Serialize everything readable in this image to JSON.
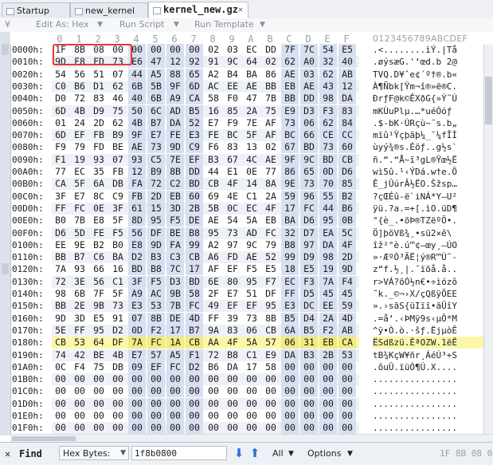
{
  "tabs": [
    {
      "label": "Startup",
      "active": false
    },
    {
      "label": "new_kernel",
      "active": false
    },
    {
      "label": "kernel_new.gz",
      "active": true
    }
  ],
  "toolbar": {
    "edit_as": "Edit As: Hex",
    "run_script": "Run Script",
    "run_template": "Run Template"
  },
  "header": {
    "columns": [
      "0",
      "1",
      "2",
      "3",
      "4",
      "5",
      "6",
      "7",
      "8",
      "9",
      "A",
      "B",
      "C",
      "D",
      "E",
      "F"
    ],
    "ascii": "0123456789ABCDEF"
  },
  "rows": [
    {
      "addr": "0000h:",
      "bytes": [
        "1F",
        "8B",
        "08",
        "00",
        "00",
        "00",
        "00",
        "00",
        "02",
        "03",
        "EC",
        "DD",
        "7F",
        "7C",
        "54",
        "E5"
      ],
      "ascii": ".<........ìÝ.|Tå"
    },
    {
      "addr": "0010h:",
      "bytes": [
        "9D",
        "F8",
        "FD",
        "73",
        "E6",
        "47",
        "12",
        "92",
        "91",
        "9C",
        "64",
        "02",
        "62",
        "A0",
        "32",
        "40"
      ],
      "ascii": ".øýsæG.'‘œd.b 2@"
    },
    {
      "addr": "0020h:",
      "bytes": [
        "54",
        "56",
        "51",
        "07",
        "44",
        "A5",
        "88",
        "65",
        "A2",
        "B4",
        "BA",
        "86",
        "AE",
        "03",
        "62",
        "AB"
      ],
      "ascii": "TVQ.D¥ˆe¢´º†®.b«"
    },
    {
      "addr": "0030h:",
      "bytes": [
        "C0",
        "B6",
        "D1",
        "62",
        "6B",
        "5B",
        "9F",
        "6D",
        "AC",
        "EE",
        "AE",
        "BB",
        "EB",
        "AE",
        "43",
        "12"
      ],
      "ascii": "À¶Ñbk[Ÿm¬î®»ë®C."
    },
    {
      "addr": "0040h:",
      "bytes": [
        "D0",
        "72",
        "83",
        "46",
        "40",
        "6B",
        "A9",
        "CA",
        "58",
        "F0",
        "47",
        "7B",
        "BB",
        "DD",
        "98",
        "DA"
      ],
      "ascii": "ÐrƒF@k©ÊXðG{»Ý˜Ú"
    },
    {
      "addr": "0050h:",
      "bytes": [
        "6D",
        "4B",
        "D9",
        "75",
        "50",
        "6C",
        "AD",
        "B5",
        "16",
        "85",
        "2A",
        "75",
        "E9",
        "D3",
        "F3",
        "83"
      ],
      "ascii": "mKÙuPl­µ.…*uéÓóƒ"
    },
    {
      "addr": "0060h:",
      "bytes": [
        "01",
        "24",
        "2D",
        "62",
        "4B",
        "B7",
        "DA",
        "52",
        "E7",
        "F9",
        "7E",
        "AF",
        "73",
        "06",
        "62",
        "84"
      ],
      "ascii": ".$-bK·ÚRçù~¯s.b„"
    },
    {
      "addr": "0070h:",
      "bytes": [
        "6D",
        "EF",
        "FB",
        "B9",
        "9F",
        "E7",
        "FE",
        "E3",
        "FE",
        "BC",
        "5F",
        "AF",
        "BC",
        "66",
        "CE",
        "CC"
      ],
      "ascii": "mïû¹Ÿçþãþ¼_¯¼fÎÌ"
    },
    {
      "addr": "0080h:",
      "bytes": [
        "F9",
        "79",
        "FD",
        "BE",
        "AE",
        "73",
        "9D",
        "C9",
        "F6",
        "83",
        "13",
        "02",
        "67",
        "BD",
        "73",
        "60"
      ],
      "ascii": "ùyý¾®s.Éöƒ..g½s`"
    },
    {
      "addr": "0090h:",
      "bytes": [
        "F1",
        "19",
        "93",
        "07",
        "93",
        "C5",
        "7E",
        "EF",
        "B3",
        "67",
        "4C",
        "AE",
        "9F",
        "9C",
        "BD",
        "CB"
      ],
      "ascii": "ñ.“.“Å~ï³gL®Ÿœ½Ë"
    },
    {
      "addr": "00A0h:",
      "bytes": [
        "77",
        "EC",
        "35",
        "FB",
        "12",
        "B9",
        "8B",
        "DD",
        "44",
        "E1",
        "0E",
        "77",
        "86",
        "65",
        "0D",
        "D6"
      ],
      "ascii": "wì5û.¹‹ÝDá.w†e.Ö"
    },
    {
      "addr": "00B0h:",
      "bytes": [
        "CA",
        "5F",
        "6A",
        "DB",
        "FA",
        "72",
        "C2",
        "BD",
        "CB",
        "4F",
        "14",
        "8A",
        "9E",
        "73",
        "70",
        "85"
      ],
      "ascii": "Ê_jÛúrÂ½ËO.Šžsp…"
    },
    {
      "addr": "00C0h:",
      "bytes": [
        "3F",
        "E7",
        "8C",
        "C9",
        "FB",
        "2D",
        "EB",
        "60",
        "69",
        "4E",
        "C1",
        "2A",
        "59",
        "96",
        "55",
        "B2"
      ],
      "ascii": "?çŒÉû-ë`iNÁ*Y–U²"
    },
    {
      "addr": "00D0h:",
      "bytes": [
        "FF",
        "FC",
        "0E",
        "3F",
        "61",
        "15",
        "3D",
        "2B",
        "5B",
        "0C",
        "EC",
        "4F",
        "17",
        "FC",
        "44",
        "B6"
      ],
      "ascii": "ÿü.?a.=+[.ìO.üD¶"
    },
    {
      "addr": "00E0h:",
      "bytes": [
        "B0",
        "7B",
        "E8",
        "5F",
        "8D",
        "95",
        "F5",
        "DE",
        "AE",
        "54",
        "5A",
        "EB",
        "BA",
        "D6",
        "95",
        "0B"
      ],
      "ascii": "°{è_.•õÞ®TZëºÖ•."
    },
    {
      "addr": "00F0h:",
      "bytes": [
        "D6",
        "5D",
        "FE",
        "F5",
        "56",
        "DF",
        "BE",
        "B8",
        "95",
        "73",
        "AD",
        "FC",
        "32",
        "D7",
        "EA",
        "5C"
      ],
      "ascii": "Ö]þõVß¾¸•s­ü2×ê\\"
    },
    {
      "addr": "0100h:",
      "bytes": [
        "EE",
        "9E",
        "B2",
        "B0",
        "E8",
        "9D",
        "FA",
        "99",
        "A2",
        "97",
        "9C",
        "79",
        "B8",
        "97",
        "DA",
        "4F"
      ],
      "ascii": "îž²°è.ú™¢—œy¸—ÚO"
    },
    {
      "addr": "0110h:",
      "bytes": [
        "BB",
        "B7",
        "C6",
        "BA",
        "D2",
        "B3",
        "C3",
        "CB",
        "A6",
        "FD",
        "AE",
        "52",
        "99",
        "D9",
        "98",
        "2D"
      ],
      "ascii": "»·ÆºÒ³ÃË¦ý®R™Ù˜-"
    },
    {
      "addr": "0120h:",
      "bytes": [
        "7A",
        "93",
        "66",
        "16",
        "BD",
        "B8",
        "7C",
        "17",
        "AF",
        "EF",
        "F5",
        "E5",
        "18",
        "E5",
        "19",
        "9D"
      ],
      "ascii": "z“f.½¸|.¯ïõå.å.."
    },
    {
      "addr": "0130h:",
      "bytes": [
        "72",
        "3E",
        "56",
        "C1",
        "3F",
        "F5",
        "D3",
        "BD",
        "6E",
        "80",
        "95",
        "F7",
        "EC",
        "F3",
        "7A",
        "F4"
      ],
      "ascii": "r>VÁ?õÓ½n€•÷ìózô"
    },
    {
      "addr": "0140h:",
      "bytes": [
        "98",
        "6B",
        "7F",
        "5F",
        "A9",
        "AC",
        "9B",
        "58",
        "2F",
        "E7",
        "51",
        "DF",
        "FF",
        "D5",
        "45",
        "45"
      ],
      "ascii": "˜k._©¬›X/çQßÿÕEE"
    },
    {
      "addr": "0150h:",
      "bytes": [
        "BB",
        "2E",
        "9B",
        "73",
        "E3",
        "53",
        "7B",
        "FC",
        "49",
        "EF",
        "EF",
        "95",
        "E3",
        "DC",
        "EE",
        "59"
      ],
      "ascii": "».›sãS{üIïï•ãÜîY"
    },
    {
      "addr": "0160h:",
      "bytes": [
        "9D",
        "3D",
        "E5",
        "91",
        "07",
        "8B",
        "DE",
        "4D",
        "FF",
        "39",
        "73",
        "8B",
        "B5",
        "D4",
        "2A",
        "4D"
      ],
      "ascii": ".=å‘.‹ÞMÿ9s‹µÔ*M"
    },
    {
      "addr": "0170h:",
      "bytes": [
        "5E",
        "FF",
        "95",
        "D2",
        "0D",
        "F2",
        "17",
        "B7",
        "9A",
        "83",
        "06",
        "CB",
        "6A",
        "B5",
        "F2",
        "AB"
      ],
      "ascii": "^ÿ•Ò.ò.·šƒ.ËjµòÊ"
    },
    {
      "addr": "0180h:",
      "bytes": [
        "CB",
        "53",
        "64",
        "DF",
        "7A",
        "FC",
        "1A",
        "CB",
        "AA",
        "4F",
        "5A",
        "57",
        "06",
        "31",
        "EB",
        "CA"
      ],
      "ascii": "ËSdßzü.ËªOZW.1ëÊ",
      "highlight": true
    },
    {
      "addr": "0190h:",
      "bytes": [
        "74",
        "42",
        "BE",
        "4B",
        "E7",
        "57",
        "A5",
        "F1",
        "72",
        "B8",
        "C1",
        "E9",
        "DA",
        "B3",
        "2B",
        "53"
      ],
      "ascii": "tB¾KçW¥ñr¸ÁéÚ³+S"
    },
    {
      "addr": "01A0h:",
      "bytes": [
        "0C",
        "F4",
        "75",
        "DB",
        "09",
        "EF",
        "FC",
        "D2",
        "B6",
        "DA",
        "17",
        "58",
        "00",
        "00",
        "00",
        "00"
      ],
      "ascii": ".ôuÛ.ïüÒ¶Ú.X...."
    },
    {
      "addr": "01B0h:",
      "bytes": [
        "00",
        "00",
        "00",
        "00",
        "00",
        "00",
        "00",
        "00",
        "00",
        "00",
        "00",
        "00",
        "00",
        "00",
        "00",
        "00"
      ],
      "ascii": "................"
    },
    {
      "addr": "01C0h:",
      "bytes": [
        "00",
        "00",
        "00",
        "00",
        "00",
        "00",
        "00",
        "00",
        "00",
        "00",
        "00",
        "00",
        "00",
        "00",
        "00",
        "00"
      ],
      "ascii": "................"
    },
    {
      "addr": "01D0h:",
      "bytes": [
        "00",
        "00",
        "00",
        "00",
        "00",
        "00",
        "00",
        "00",
        "00",
        "00",
        "00",
        "00",
        "00",
        "00",
        "00",
        "00"
      ],
      "ascii": "................"
    },
    {
      "addr": "01E0h:",
      "bytes": [
        "00",
        "00",
        "00",
        "00",
        "00",
        "00",
        "00",
        "00",
        "00",
        "00",
        "00",
        "00",
        "00",
        "00",
        "00",
        "00"
      ],
      "ascii": "................"
    },
    {
      "addr": "01F0h:",
      "bytes": [
        "00",
        "00",
        "00",
        "00",
        "00",
        "00",
        "00",
        "00",
        "00",
        "00",
        "00",
        "00",
        "00",
        "00",
        "00",
        "00"
      ],
      "ascii": "................"
    }
  ],
  "findbar": {
    "close": "✕",
    "find": "Find",
    "type_label": "Hex Bytes:",
    "value": "1f8b0800",
    "all": "All",
    "options": "Options",
    "options_text": "1F 8B 08 00"
  },
  "colors": {
    "highlight_row": "#fbf7a8",
    "selection_box": "#e53935",
    "band": "#d8dff0",
    "arrow": "#2a6fd6"
  }
}
